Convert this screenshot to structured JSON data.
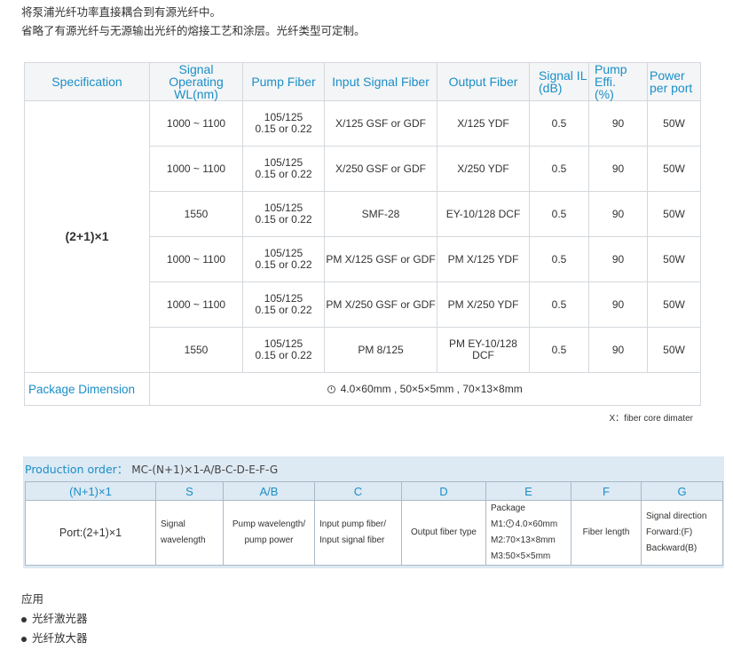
{
  "intro": {
    "line1": "将泵浦光纤功率直接耦合到有源光纤中。",
    "line2": "省略了有源光纤与无源输出光纤的熔接工艺和涂层。光纤类型可定制。"
  },
  "spec_table": {
    "headers": {
      "specification": "Specification",
      "signal_wl_1": "Signal Operating",
      "signal_wl_2": "WL(nm)",
      "pump_fiber": "Pump Fiber",
      "input_signal_fiber": "Input Signal Fiber",
      "output_fiber": "Output Fiber",
      "signal_il_1": "Signal IL",
      "signal_il_2": "(dB)",
      "pump_eff_1": "Pump Effi.",
      "pump_eff_2": "(%)",
      "power_1": "Power",
      "power_2": "per port"
    },
    "model": "(2+1)×1",
    "rows": [
      {
        "wl": "1000 ~ 1100",
        "pump1": "105/125",
        "pump2": "0.15 or 0.22",
        "input": "X/125 GSF or GDF",
        "output": "X/125 YDF",
        "il": "0.5",
        "eff": "90",
        "power": "50W"
      },
      {
        "wl": "1000 ~ 1100",
        "pump1": "105/125",
        "pump2": "0.15 or 0.22",
        "input": "X/250 GSF or GDF",
        "output": "X/250 YDF",
        "il": "0.5",
        "eff": "90",
        "power": "50W"
      },
      {
        "wl": "1550",
        "pump1": "105/125",
        "pump2": "0.15 or 0.22",
        "input": "SMF-28",
        "output": "EY-10/128 DCF",
        "il": "0.5",
        "eff": "90",
        "power": "50W"
      },
      {
        "wl": "1000 ~ 1100",
        "pump1": "105/125",
        "pump2": "0.15 or 0.22",
        "input": "PM X/125 GSF or GDF",
        "output": "PM X/125 YDF",
        "il": "0.5",
        "eff": "90",
        "power": "50W"
      },
      {
        "wl": "1000 ~ 1100",
        "pump1": "105/125",
        "pump2": "0.15 or 0.22",
        "input": "PM X/250 GSF or GDF",
        "output": "PM X/250 YDF",
        "il": "0.5",
        "eff": "90",
        "power": "50W"
      },
      {
        "wl": "1550",
        "pump1": "105/125",
        "pump2": "0.15 or 0.22",
        "input": "PM 8/125",
        "output": "PM EY-10/128 DCF",
        "il": "0.5",
        "eff": "90",
        "power": "50W"
      }
    ],
    "package_label": "Package Dimension",
    "package_value": "4.0×60mm , 50×5×5mm , 70×13×8mm",
    "note": "X：fiber core dimater"
  },
  "order": {
    "title": "Production order：",
    "code": "MC-(N+1)×1-A/B-C-D-E-F-G",
    "headers": [
      "(N+1)×1",
      "S",
      "A/B",
      "C",
      "D",
      "E",
      "F",
      "G"
    ],
    "port": "Port:(2+1)×1",
    "s": [
      "Signal",
      "wavelength"
    ],
    "ab": [
      "Pump wavelength/",
      "pump power"
    ],
    "c": [
      "Input pump fiber/",
      "Input signal fiber"
    ],
    "d": "Output fiber type",
    "e": [
      "Package",
      "M1:",
      "4.0×60mm",
      "M2:70×13×8mm",
      "M3:50×5×5mm"
    ],
    "f": "Fiber length",
    "g": [
      "Signal direction",
      "Forward:(F)",
      "Backward(B)"
    ]
  },
  "application": {
    "title": "应用",
    "items": [
      "光纤激光器",
      "光纤放大器"
    ]
  }
}
